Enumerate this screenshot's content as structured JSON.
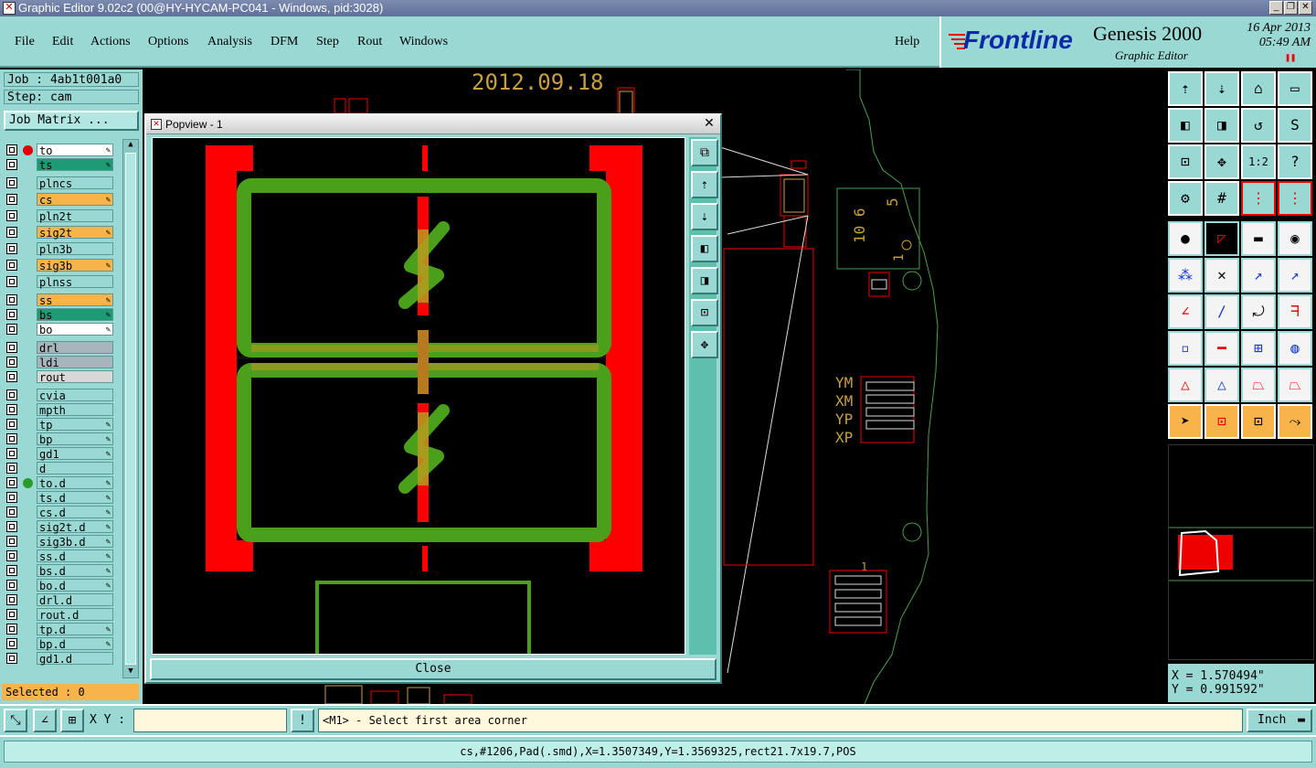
{
  "window": {
    "title": "Graphic Editor 9.02c2 (00@HY-HYCAM-PC041 - Windows, pid:3028)",
    "minimize": "_",
    "maximize": "❐",
    "close": "✕"
  },
  "menu": [
    "File",
    "Edit",
    "Actions",
    "Options",
    "Analysis",
    "DFM",
    "Step",
    "Rout",
    "Windows"
  ],
  "help": "Help",
  "brand": {
    "logo": "Frontline",
    "product": "Genesis 2000",
    "subtitle": "Graphic Editor",
    "date": "16 Apr 2013",
    "time": "05:49 AM"
  },
  "job": {
    "job": "Job : 4ab1t001a0",
    "step": "Step: cam",
    "matrix_button": "Job Matrix ..."
  },
  "layers": [
    {
      "name": "to",
      "color": "#ffffff",
      "dot": "#e00000",
      "editable": true
    },
    {
      "name": "ts",
      "color": "#1e9a74",
      "editable": true
    },
    {
      "name": "plncs",
      "color": "#9ad8d4"
    },
    {
      "name": "cs",
      "color": "#f6b44a",
      "editable": true
    },
    {
      "name": "pln2t",
      "color": "#9ad8d4"
    },
    {
      "name": "sig2t",
      "color": "#f6b44a",
      "editable": true
    },
    {
      "name": "pln3b",
      "color": "#9ad8d4"
    },
    {
      "name": "sig3b",
      "color": "#f6b44a",
      "editable": true
    },
    {
      "name": "plnss",
      "color": "#9ad8d4"
    },
    {
      "name": "ss",
      "color": "#f6b44a",
      "editable": true
    },
    {
      "name": "bs",
      "color": "#1e9a74",
      "editable": true
    },
    {
      "name": "bo",
      "color": "#ffffff",
      "editable": true
    },
    {
      "name": "drl",
      "color": "#a8b4bc"
    },
    {
      "name": "ldi",
      "color": "#a8b4bc"
    },
    {
      "name": "rout",
      "color": "#d8d8d8"
    },
    {
      "name": "cvia",
      "color": "#9ad8d4"
    },
    {
      "name": "mpth",
      "color": "#9ad8d4"
    },
    {
      "name": "tp",
      "color": "#9ad8d4",
      "editable": true
    },
    {
      "name": "bp",
      "color": "#9ad8d4",
      "editable": true
    },
    {
      "name": "gd1",
      "color": "#9ad8d4",
      "editable": true
    },
    {
      "name": "d",
      "color": "#9ad8d4"
    },
    {
      "name": "to.d",
      "color": "#9ad8d4",
      "dot": "#2a9a2a",
      "editable": true
    },
    {
      "name": "ts.d",
      "color": "#9ad8d4",
      "editable": true
    },
    {
      "name": "cs.d",
      "color": "#9ad8d4",
      "editable": true
    },
    {
      "name": "sig2t.d",
      "color": "#9ad8d4",
      "editable": true
    },
    {
      "name": "sig3b.d",
      "color": "#9ad8d4",
      "editable": true
    },
    {
      "name": "ss.d",
      "color": "#9ad8d4",
      "editable": true
    },
    {
      "name": "bs.d",
      "color": "#9ad8d4",
      "editable": true
    },
    {
      "name": "bo.d",
      "color": "#9ad8d4",
      "editable": true
    },
    {
      "name": "drl.d",
      "color": "#9ad8d4"
    },
    {
      "name": "rout.d",
      "color": "#9ad8d4"
    },
    {
      "name": "tp.d",
      "color": "#9ad8d4",
      "editable": true
    },
    {
      "name": "bp.d",
      "color": "#9ad8d4",
      "editable": true
    },
    {
      "name": "gd1.d",
      "color": "#9ad8d4"
    }
  ],
  "selected": "Selected : 0",
  "canvas": {
    "date_text": "2012.09.18",
    "silk_labels": [
      "YM",
      "XM",
      "YP",
      "XP"
    ],
    "part_label_a": "10 6",
    "part_label_b": "5",
    "part_label_c": "1",
    "pin_label": "1"
  },
  "popview": {
    "title": "Popview - 1",
    "close": "Close"
  },
  "coords": {
    "x": "X = 1.570494\"",
    "y": "Y = 0.991592\""
  },
  "cmd": {
    "xy_label": "X Y :",
    "xy_value": "",
    "prompt": "<M1> - Select first area corner",
    "units": "Inch"
  },
  "status": "cs,#1206,Pad(.smd),X=1.3507349,Y=1.3569325,rect21.7x19.7,POS"
}
